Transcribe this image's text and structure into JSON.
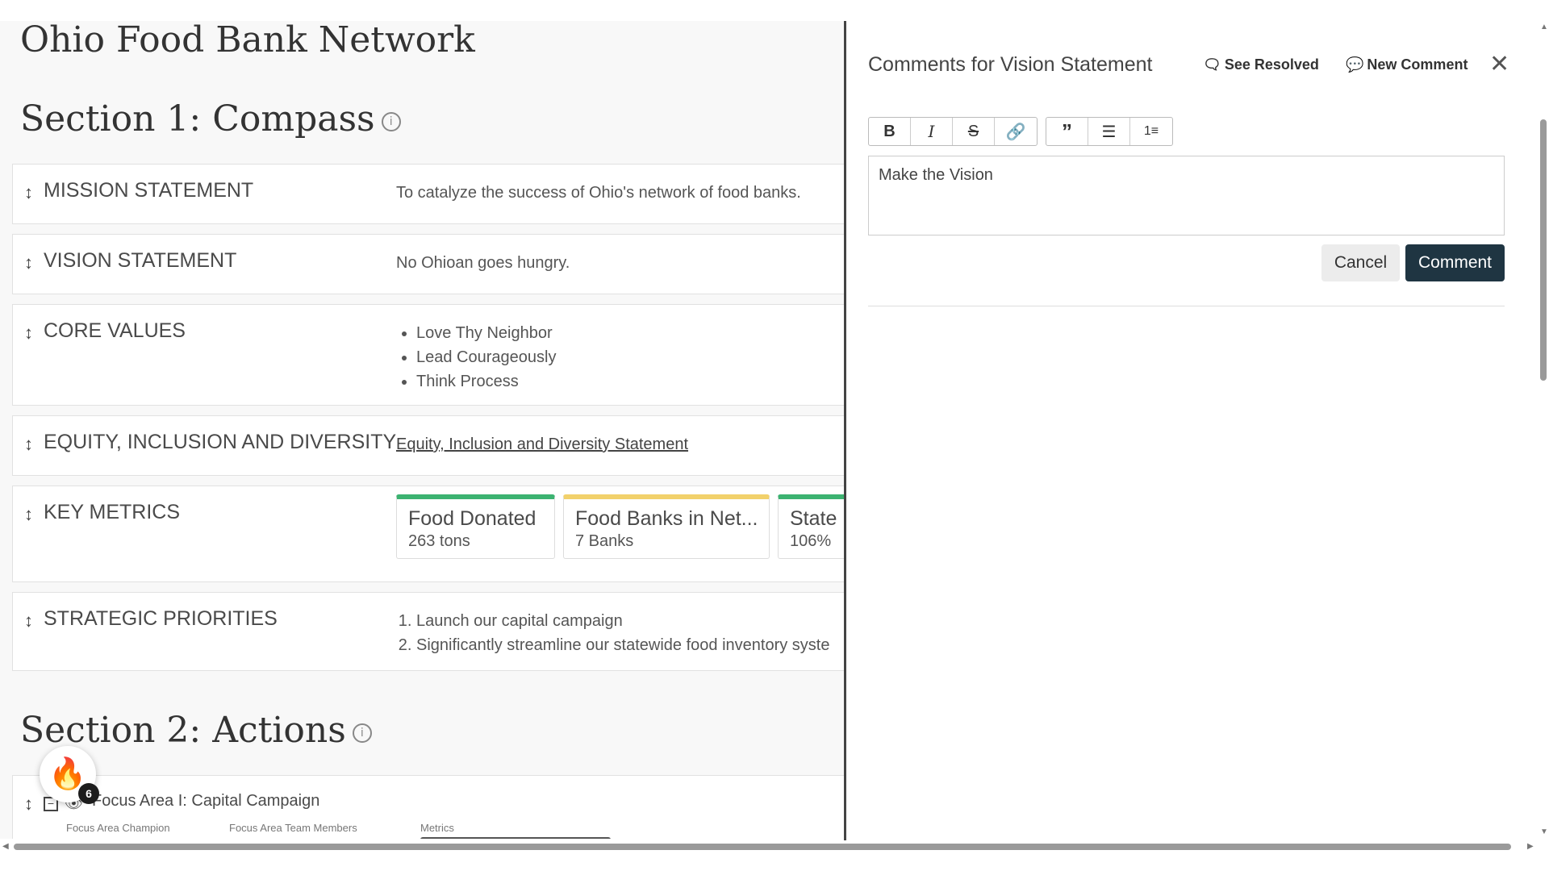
{
  "document": {
    "org_title": "Ohio Food Bank Network",
    "section1_title": "Section 1: Compass",
    "section2_title": "Section 2: Actions",
    "rows": {
      "mission": {
        "label": "MISSION STATEMENT",
        "text": "To catalyze the success of Ohio's network of food banks."
      },
      "vision": {
        "label": "VISION STATEMENT",
        "text": "No Ohioan goes hungry."
      },
      "core_values": {
        "label": "CORE VALUES",
        "items": [
          "Love Thy Neighbor",
          "Lead Courageously",
          "Think Process"
        ]
      },
      "equity": {
        "label": "EQUITY, INCLUSION AND DIVERSITY",
        "link_text": "Equity, Inclusion and Diversity Statement"
      },
      "key_metrics": {
        "label": "KEY METRICS",
        "cards": [
          {
            "title": "Food Donated",
            "value": "263 tons",
            "color": "#3cb371"
          },
          {
            "title": "Food Banks in Net...",
            "value": "7 Banks",
            "color": "#f2d16b"
          },
          {
            "title": "State",
            "value": "106%",
            "color": "#3cb371"
          }
        ]
      },
      "priorities": {
        "label": "STRATEGIC PRIORITIES",
        "items": [
          "Launch our capital campaign",
          "Significantly streamline our statewide food inventory syste"
        ]
      }
    },
    "focus_area": {
      "title": "Focus Area I: Capital Campaign",
      "col_champion": "Focus Area Champion",
      "col_team": "Focus Area Team Members",
      "col_metrics": "Metrics"
    },
    "badge_count": "6"
  },
  "panel": {
    "title": "Comments for Vision Statement",
    "see_resolved": "See Resolved",
    "new_comment": "New Comment",
    "editor_text": "Make the Vision",
    "cancel_label": "Cancel",
    "comment_label": "Comment",
    "toolbar_icons": [
      "bold-icon",
      "italic-icon",
      "strikethrough-icon",
      "link-icon",
      "quote-icon",
      "bullet-list-icon",
      "numbered-list-icon"
    ]
  }
}
